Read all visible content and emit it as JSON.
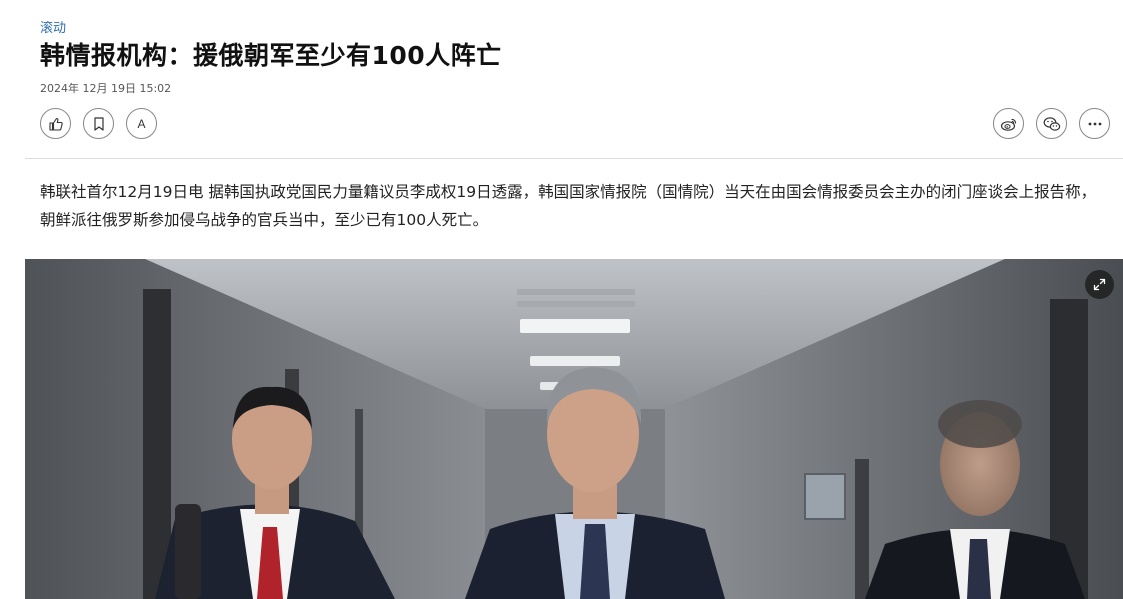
{
  "article": {
    "category": "滚动",
    "title": "韩情报机构：援俄朝军至少有100人阵亡",
    "date": "2024年 12月 19日 15:02",
    "lead": "韩联社首尔12月19日电 据韩国执政党国民力量籍议员李成权19日透露，韩国国家情报院（国情院）当天在由国会情报委员会主办的闭门座谈会上报告称，朝鲜派往俄罗斯参加侵乌战争的官兵当中，至少已有100人死亡。"
  },
  "toolbar": {
    "font_label": "A",
    "left_icons": [
      "thumbs-up-icon",
      "bookmark-icon",
      "font-size-icon"
    ],
    "right_icons": [
      "weibo-icon",
      "wechat-icon",
      "more-icon"
    ]
  },
  "photo": {
    "expand_icon": "expand-icon"
  },
  "colors": {
    "category": "#2f6db5",
    "title": "#111111",
    "divider": "#dcdcdc"
  }
}
